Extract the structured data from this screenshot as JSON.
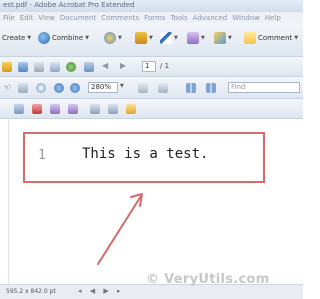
{
  "window": {
    "title": "est.pdf - Adobe Acrobat Pro Extended"
  },
  "menubar": {
    "items": [
      "File",
      "Edit",
      "View",
      "Document",
      "Comments",
      "Forms",
      "Tools",
      "Advanced",
      "Window",
      "Help"
    ]
  },
  "toolbar1": {
    "create_label": "Create",
    "combine_label": "Combine",
    "comment_label": "Comment"
  },
  "toolbar2": {
    "page_current": "1",
    "page_total": "/ 1"
  },
  "toolbar3": {
    "zoom_value": "280%",
    "find_placeholder": "Find"
  },
  "document": {
    "line_number": "1",
    "text": "This is a test."
  },
  "statusbar": {
    "page_size": "595.2 x 842.0 pt"
  },
  "watermark": {
    "text": "© VeryUtils.com"
  },
  "colors": {
    "highlight_box": "#d46a6a",
    "toolbar_bg": "#e4eaf2"
  }
}
